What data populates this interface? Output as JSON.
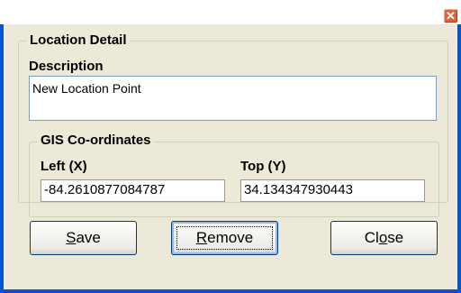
{
  "window": {
    "close_glyph": "✕"
  },
  "location_group": {
    "title": "Location Detail",
    "description_label": "Description",
    "description_value": "New Location Point"
  },
  "gis_group": {
    "title": "GIS Co-ordinates",
    "left_label": "Left (X)",
    "left_value": "-84.2610877084787",
    "top_label": "Top (Y)",
    "top_value": "34.134347930443"
  },
  "buttons": {
    "save": {
      "accel": "S",
      "rest": "ave"
    },
    "remove": {
      "accel": "R",
      "rest": "emove"
    },
    "close": {
      "pre": "Cl",
      "accel": "o",
      "rest": "se"
    }
  },
  "colors": {
    "dialog_bg": "#ece9d8",
    "frame_blue": "#0a52d0",
    "close_red": "#e0603f"
  }
}
